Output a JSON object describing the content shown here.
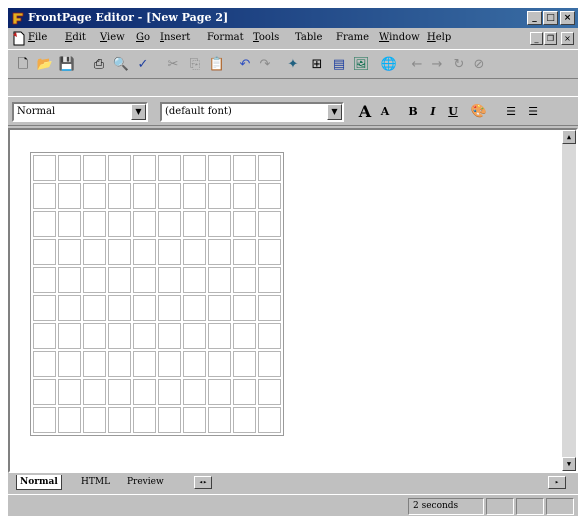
{
  "window": {
    "title": "FrontPage Editor - [New Page 2]"
  },
  "menubar": {
    "items": [
      {
        "mnemonic": "F",
        "rest": "ile"
      },
      {
        "mnemonic": "E",
        "rest": "dit"
      },
      {
        "mnemonic": "V",
        "rest": "iew"
      },
      {
        "mnemonic": "G",
        "rest": "o"
      },
      {
        "mnemonic": "I",
        "rest": "nsert"
      },
      {
        "mnemonic": "",
        "rest": "Format"
      },
      {
        "mnemonic": "T",
        "rest": "ools"
      },
      {
        "mnemonic": "",
        "rest": "Table"
      },
      {
        "mnemonic": "",
        "rest": "Frame"
      },
      {
        "mnemonic": "W",
        "rest": "indow"
      },
      {
        "mnemonic": "H",
        "rest": "elp"
      }
    ]
  },
  "format_toolbar": {
    "style_value": "Normal",
    "font_value": "(default font)",
    "bold_label": "B",
    "italic_label": "I",
    "underline_label": "U"
  },
  "editor": {
    "table": {
      "rows": 10,
      "cols": 10
    }
  },
  "tabs": {
    "items": [
      "Normal",
      "HTML",
      "Preview"
    ]
  },
  "statusbar": {
    "load_time": "2 seconds"
  },
  "colors": {
    "titlebar_start": "#0a246a",
    "titlebar_end": "#3a6ea5",
    "chrome": "#c0c0c0"
  }
}
